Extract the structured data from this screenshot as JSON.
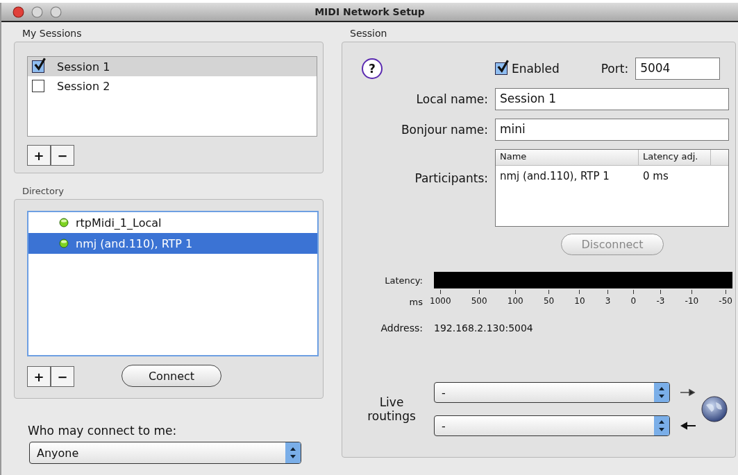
{
  "window": {
    "title": "MIDI Network Setup"
  },
  "my_sessions": {
    "title": "My Sessions",
    "add_button": "+",
    "remove_button": "−",
    "sessions": [
      {
        "name": "Session 1",
        "checked": true,
        "selected": true
      },
      {
        "name": "Session 2",
        "checked": false,
        "selected": false
      }
    ]
  },
  "directory": {
    "title": "Directory",
    "add_button": "+",
    "remove_button": "−",
    "connect_button": "Connect",
    "items": [
      {
        "name": "rtpMidi_1_Local",
        "selected": false
      },
      {
        "name": "nmj (and.110), RTP 1",
        "selected": true
      }
    ]
  },
  "access": {
    "label": "Who may connect to me:",
    "value": "Anyone"
  },
  "session": {
    "title": "Session",
    "help": "?",
    "enabled": {
      "label": "Enabled",
      "checked": true
    },
    "port": {
      "label": "Port:",
      "value": "5004"
    },
    "local_name": {
      "label": "Local name:",
      "value": "Session 1"
    },
    "bonjour_name": {
      "label": "Bonjour name:",
      "value": "mini"
    },
    "participants": {
      "label": "Participants:",
      "columns": [
        "Name",
        "Latency adj."
      ],
      "rows": [
        [
          "nmj (and.110), RTP 1",
          "0 ms"
        ]
      ]
    },
    "disconnect_button": {
      "label": "Disconnect",
      "disabled": true
    },
    "latency": {
      "label": "Latency:",
      "unit": "ms",
      "ticks": [
        "1000",
        "500",
        "100",
        "50",
        "10",
        "3",
        "0",
        "-3",
        "-10",
        "-50"
      ]
    },
    "address": {
      "label": "Address:",
      "value": "192.168.2.130:5004"
    },
    "live_routings": {
      "label": "Live routings",
      "routes": [
        {
          "kind": "output",
          "value": "-"
        },
        {
          "kind": "input",
          "value": "-"
        }
      ]
    }
  }
}
